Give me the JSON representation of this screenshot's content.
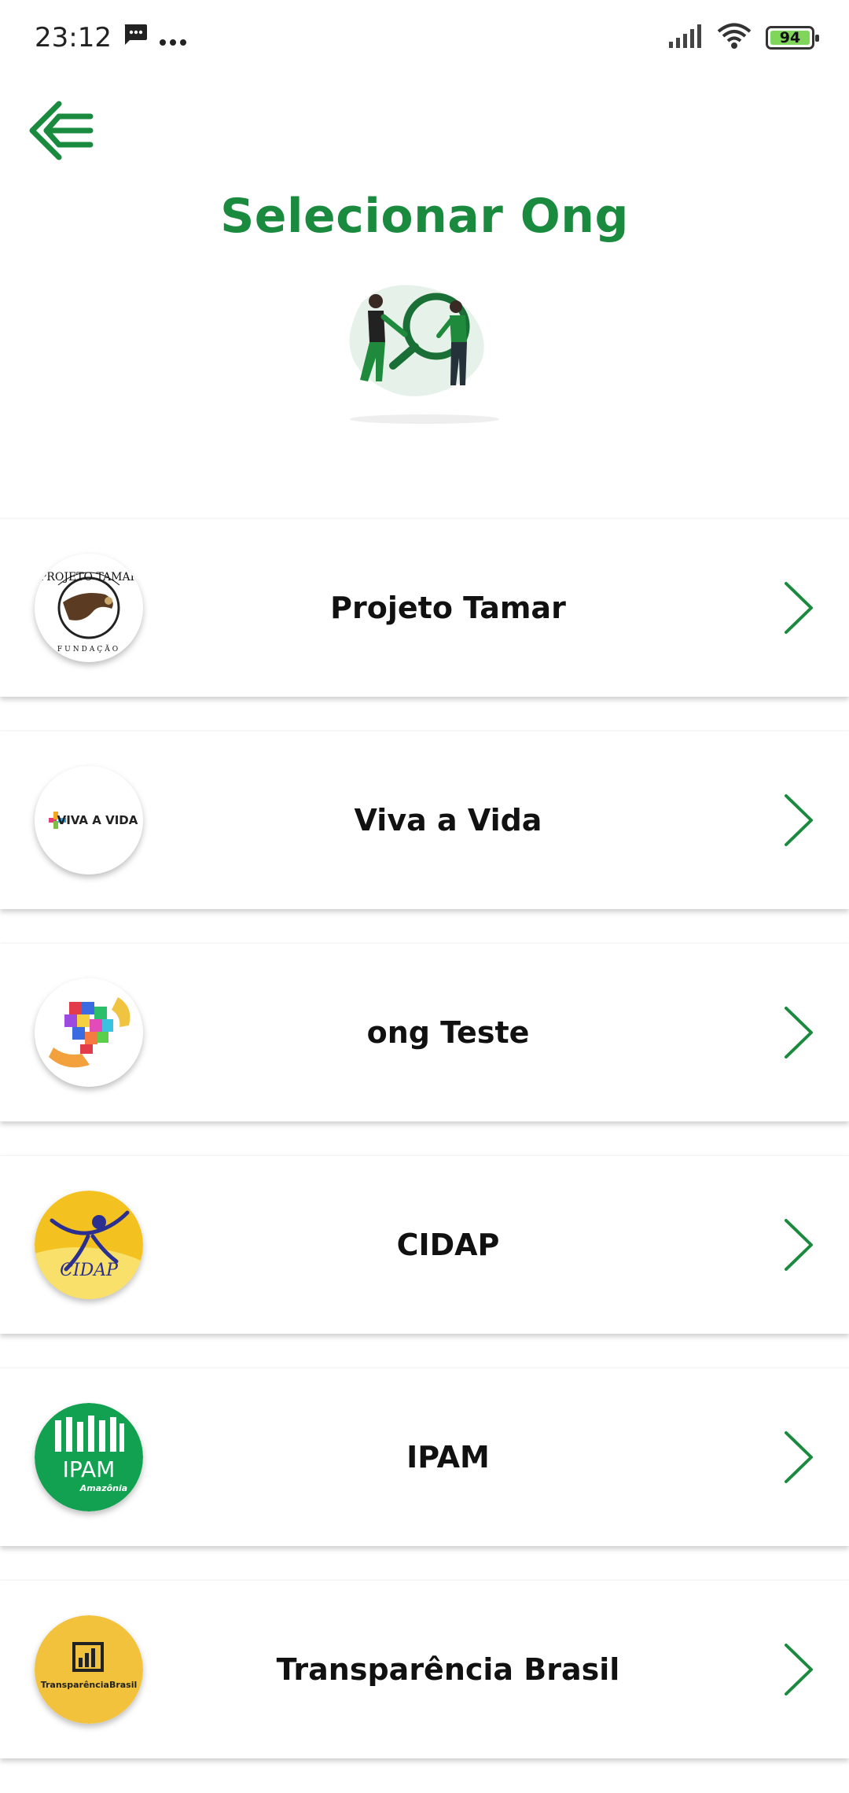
{
  "status_bar": {
    "time": "23:12",
    "battery": "94",
    "icons": [
      "message-icon",
      "more-dots-icon",
      "signal-icon",
      "wifi-icon",
      "battery-icon"
    ]
  },
  "header": {
    "back_icon": "back-arrow-icon",
    "title": "Selecionar Ong"
  },
  "colors": {
    "accent": "#1a8a3f",
    "text": "#111111",
    "background": "#ffffff"
  },
  "ongs": [
    {
      "name": "Projeto Tamar",
      "logo_text": "PROJETO TAMAR",
      "logo_subtext": "FUNDAÇÃO"
    },
    {
      "name": "Viva a Vida",
      "logo_text": "VIVA A VIDA"
    },
    {
      "name": "ong Teste"
    },
    {
      "name": "CIDAP",
      "logo_text": "CIDAP"
    },
    {
      "name": "IPAM",
      "logo_text": "IPAM",
      "logo_subtext": "Amazônia"
    },
    {
      "name": "Transparência Brasil",
      "logo_text": "TransparênciaBrasil"
    }
  ]
}
